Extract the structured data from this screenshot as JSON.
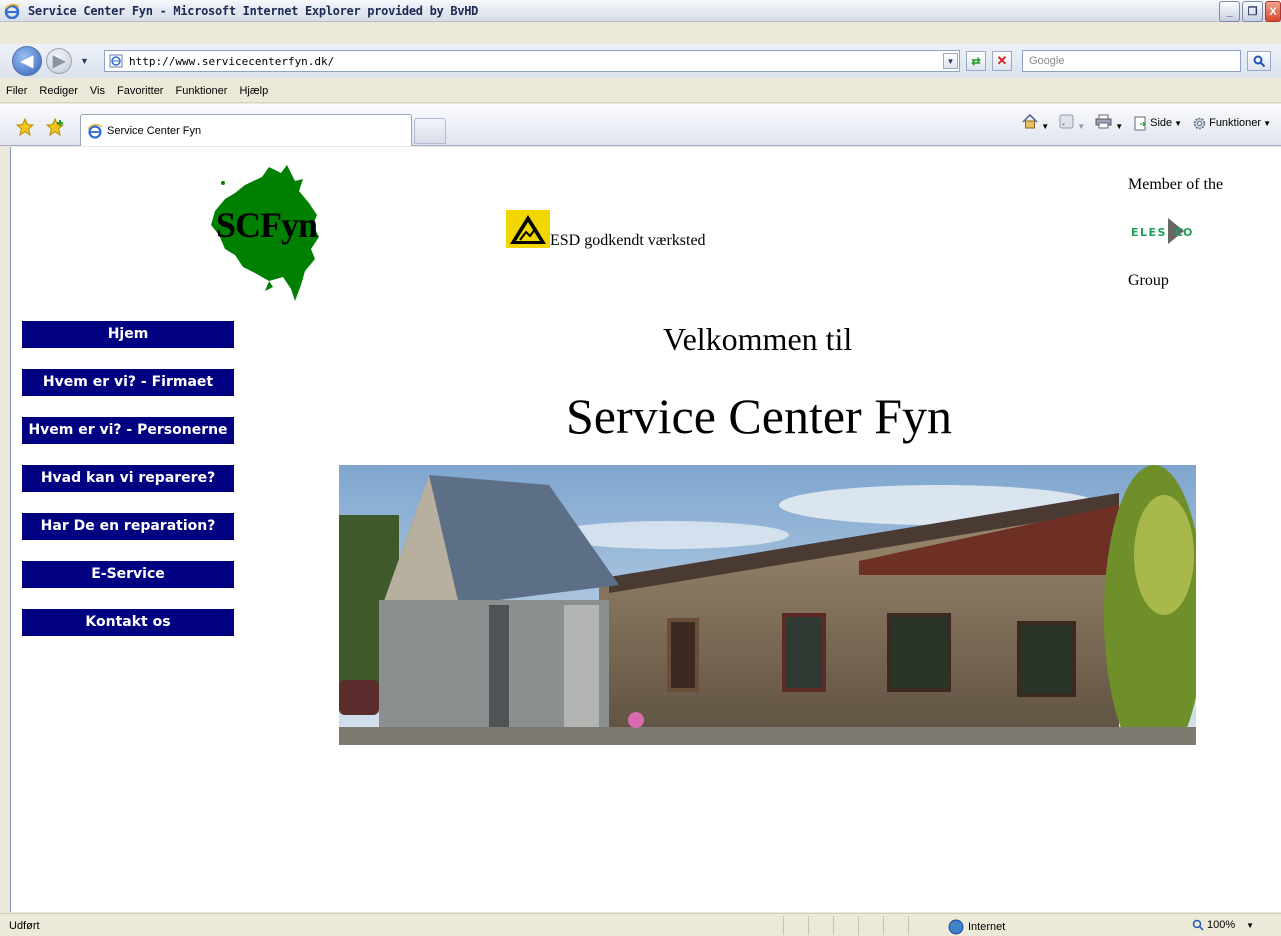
{
  "window": {
    "title": "Service Center Fyn - Microsoft Internet Explorer provided by BvHD",
    "minimize": "_",
    "restore": "❐",
    "close": "X"
  },
  "address": {
    "url": "http://www.servicecenterfyn.dk/",
    "search_placeholder": "Google"
  },
  "menubar": {
    "items": [
      "Filer",
      "Rediger",
      "Vis",
      "Favoritter",
      "Funktioner",
      "Hjælp"
    ]
  },
  "tabs": {
    "active_label": "Service Center Fyn"
  },
  "commandbar": {
    "side_label": "Side",
    "tools_label": "Funktioner"
  },
  "page": {
    "logo_text": "SCFyn",
    "esd_label": "ESD godkendt værksted",
    "member_of": "Member of the",
    "group": "Group",
    "elesco_logo_text": "ELESCO",
    "welcome": "Velkommen til",
    "site_name": "Service Center Fyn",
    "nav": [
      "Hjem",
      "Hvem er vi? - Firmaet",
      "Hvem er vi? - Personerne",
      "Hvad kan vi reparere?",
      "Har De en reparation?",
      "E-Service",
      "Kontakt os"
    ],
    "nav_color": "#000080",
    "logo_color": "#008000"
  },
  "statusbar": {
    "status": "Udført",
    "zone": "Internet",
    "zoom": "100%"
  }
}
